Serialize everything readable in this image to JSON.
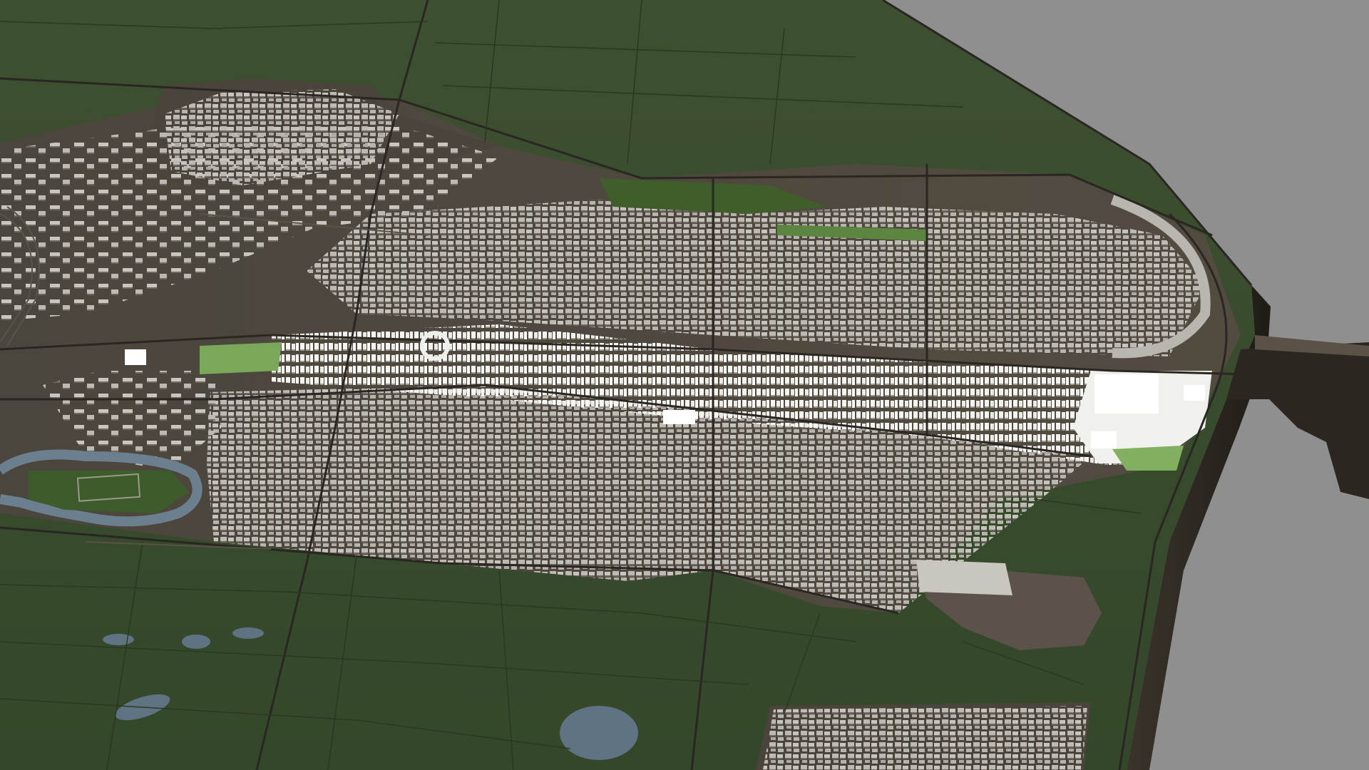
{
  "scene": {
    "description_kind": "3d-render",
    "colors": {
      "background": "#8f8f8f",
      "terrain": "#3b4d2c",
      "terrain_dark": "#2e3d22",
      "urban_ground": "#4a4339",
      "road": "#2c2823",
      "water": "#5e7384",
      "park": "#6a9a4a",
      "building_light": "#d9d9d6",
      "building_lit": "#f2f2ef",
      "building_shade": "#8c8a86",
      "edge_wall": "#2a2620"
    }
  }
}
